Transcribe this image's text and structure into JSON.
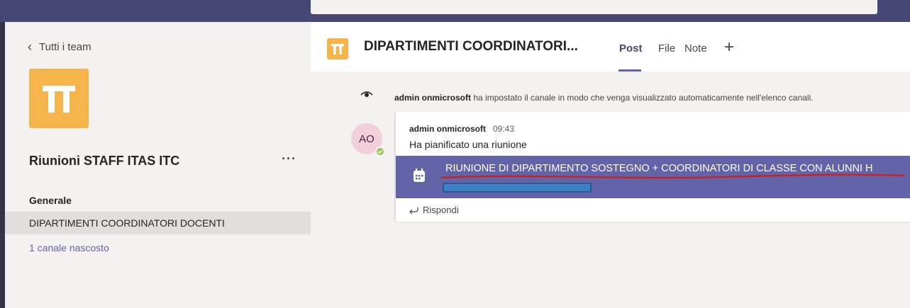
{
  "sidebar": {
    "back_label": "Tutti i team",
    "team_name": "Riunioni STAFF ITAS ITC",
    "more_label": "···",
    "section_title": "Generale",
    "channel": "DIPARTIMENTI COORDINATORI DOCENTI",
    "hidden_channels": "1 canale nascosto"
  },
  "header": {
    "channel_title": "DIPARTIMENTI COORDINATORI...",
    "tabs": [
      {
        "label": "Post",
        "active": true
      },
      {
        "label": "File",
        "active": false
      },
      {
        "label": "Note",
        "active": false
      }
    ],
    "add_tab": "+"
  },
  "feed": {
    "system_message": {
      "actor": "admin onmicrosoft",
      "text": " ha impostato il canale in modo che venga visualizzato automaticamente nell'elenco canali."
    },
    "post": {
      "avatar_initials": "AO",
      "author": "admin onmicrosoft",
      "time": "09:43",
      "text": "Ha pianificato una riunione",
      "meeting_title": "RIUNIONE DI DIPARTIMENTO SOSTEGNO + COORDINATORI DI CLASSE CON ALUNNI H",
      "reply_label": "Rispondi"
    }
  },
  "colors": {
    "accent": "#6264a7",
    "topbar": "#464775",
    "team_logo": "#f6b54a",
    "presence": "#92c353",
    "annotation_line": "#d01c1c",
    "redaction": "#3d80c6"
  },
  "icons": {
    "team_logo": "pi-icon",
    "system": "eye-icon",
    "meeting": "calendar-icon",
    "reply": "reply-arrow-icon"
  }
}
